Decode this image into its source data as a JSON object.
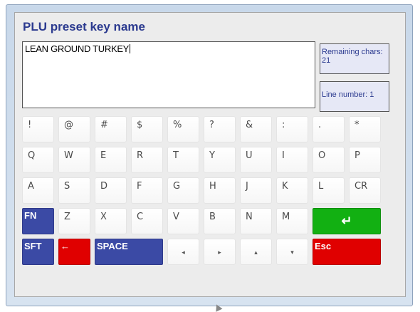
{
  "dialog": {
    "title": "PLU preset key name",
    "text_value": "LEAN GROUND TURKEY",
    "remaining_label": "Remaining chars: 21",
    "line_label": "Line number: 1"
  },
  "keyboard": {
    "row1": [
      "!",
      "@",
      "#",
      "$",
      "%",
      "?",
      "&",
      ":",
      ".",
      "*"
    ],
    "row2": [
      "Q",
      "W",
      "E",
      "R",
      "T",
      "Y",
      "U",
      "I",
      "O",
      "P"
    ],
    "row3": [
      "A",
      "S",
      "D",
      "F",
      "G",
      "H",
      "J",
      "K",
      "L",
      "CR"
    ],
    "row4": [
      "FN",
      "Z",
      "X",
      "C",
      "V",
      "B",
      "N",
      "M",
      "↵"
    ],
    "row5": [
      "SFT",
      "←",
      "SPACE",
      "◂",
      "▸",
      "▴",
      "▾",
      "Esc"
    ]
  },
  "colors": {
    "title": "#2b3a8f",
    "key_blue": "#3b4aa5",
    "key_red": "#e00000",
    "key_green": "#12b012"
  }
}
